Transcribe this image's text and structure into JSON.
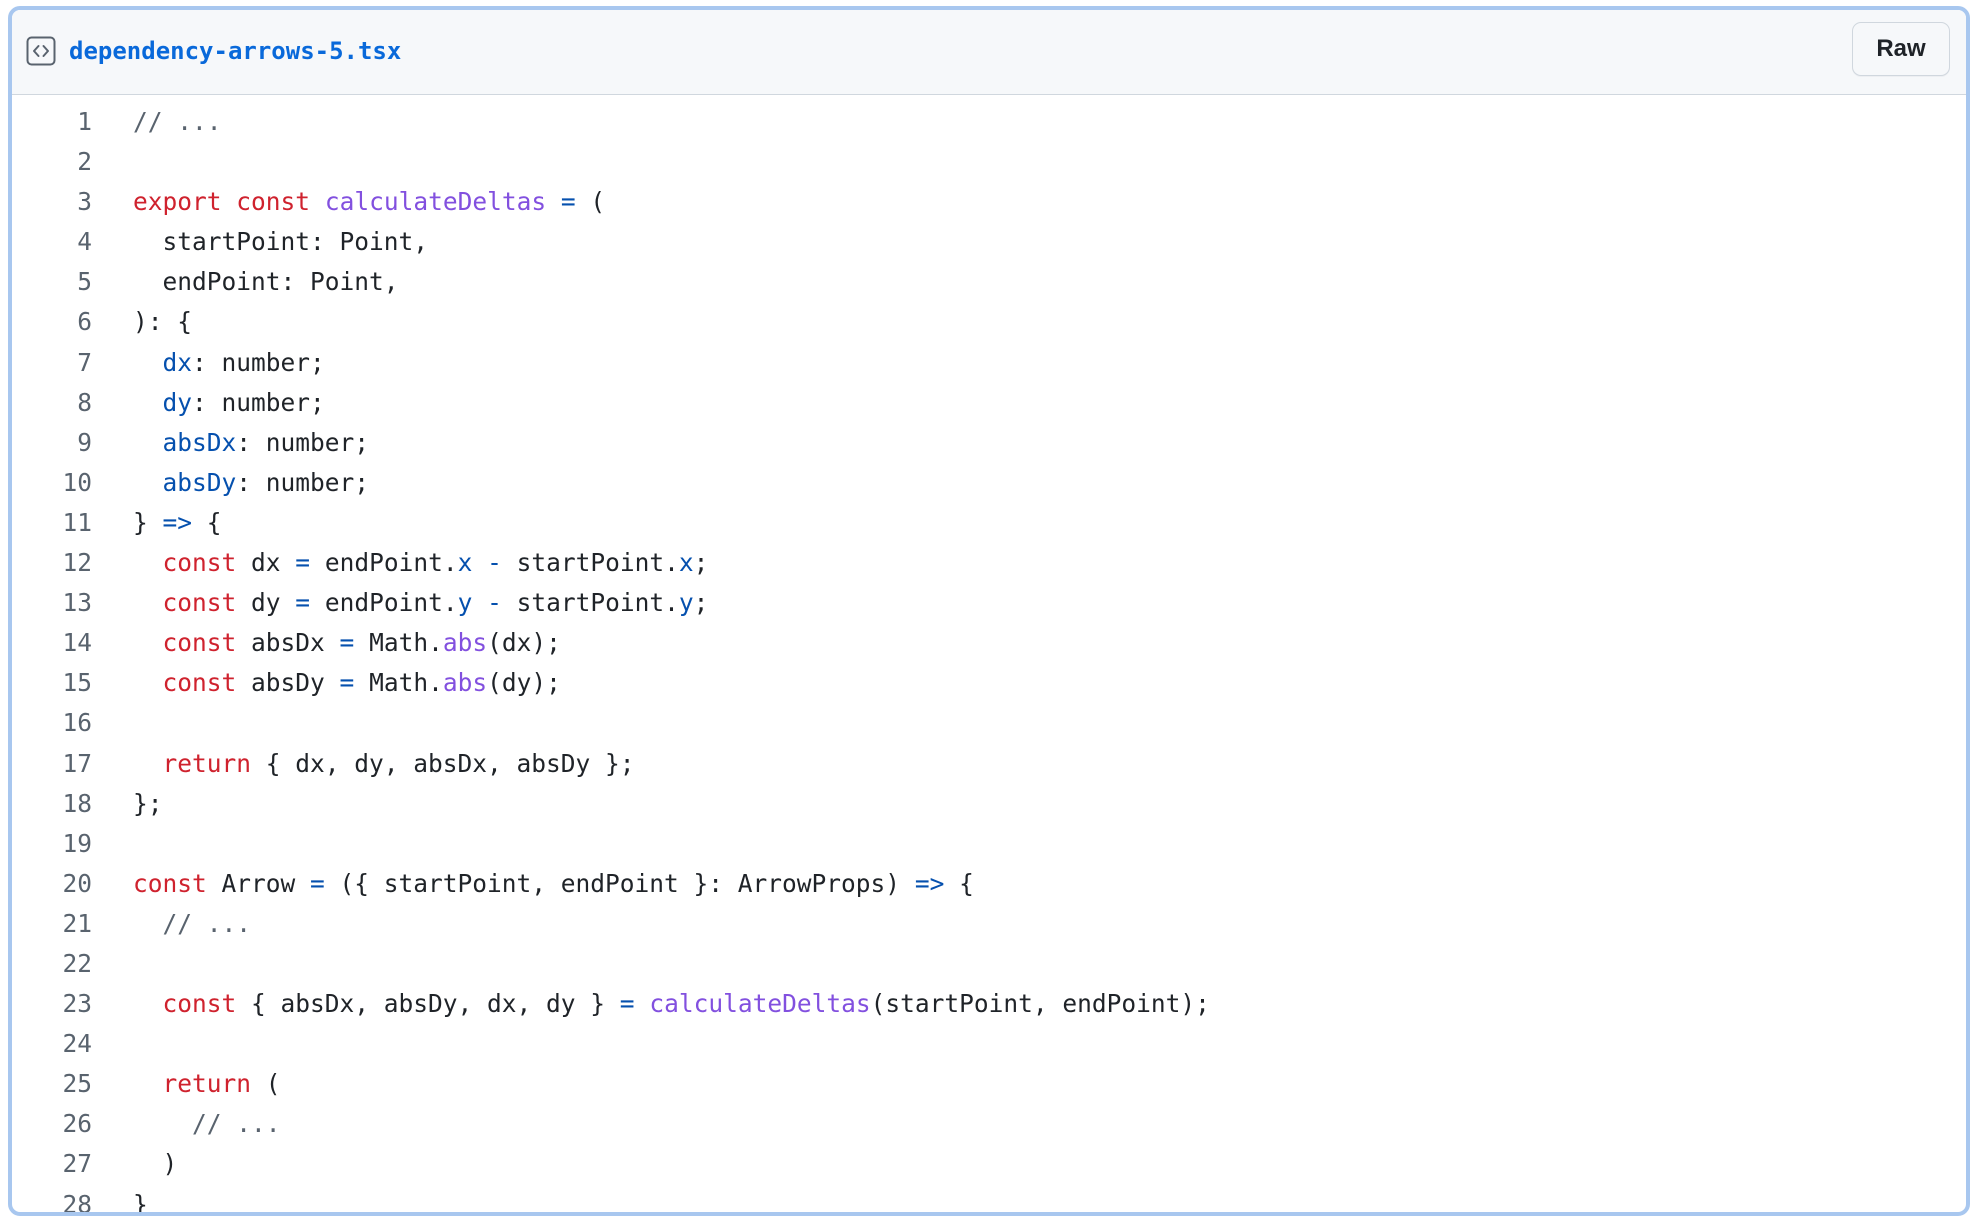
{
  "file": {
    "name": "dependency-arrows-5.tsx",
    "icon": "code-file-icon",
    "raw_label": "Raw"
  },
  "colors": {
    "link": "#0969da",
    "keyword": "#cf222e",
    "function": "#8250df",
    "operator": "#0550ae",
    "property": "#0550ae",
    "comment": "#59636e",
    "text": "#1f2328",
    "line_number": "#59636e"
  },
  "code": {
    "lines": [
      {
        "number": "1",
        "tokens": [
          [
            "comment",
            "// ..."
          ]
        ]
      },
      {
        "number": "2",
        "tokens": []
      },
      {
        "number": "3",
        "tokens": [
          [
            "keyword",
            "export"
          ],
          [
            "plain",
            " "
          ],
          [
            "keyword",
            "const"
          ],
          [
            "plain",
            " "
          ],
          [
            "function",
            "calculateDeltas"
          ],
          [
            "plain",
            " "
          ],
          [
            "operator",
            "="
          ],
          [
            "plain",
            " ("
          ]
        ]
      },
      {
        "number": "4",
        "tokens": [
          [
            "plain",
            "  startPoint: Point,"
          ]
        ]
      },
      {
        "number": "5",
        "tokens": [
          [
            "plain",
            "  endPoint: Point,"
          ]
        ]
      },
      {
        "number": "6",
        "tokens": [
          [
            "plain",
            "): {"
          ]
        ]
      },
      {
        "number": "7",
        "tokens": [
          [
            "plain",
            "  "
          ],
          [
            "property",
            "dx"
          ],
          [
            "plain",
            ": number;"
          ]
        ]
      },
      {
        "number": "8",
        "tokens": [
          [
            "plain",
            "  "
          ],
          [
            "property",
            "dy"
          ],
          [
            "plain",
            ": number;"
          ]
        ]
      },
      {
        "number": "9",
        "tokens": [
          [
            "plain",
            "  "
          ],
          [
            "property",
            "absDx"
          ],
          [
            "plain",
            ": number;"
          ]
        ]
      },
      {
        "number": "10",
        "tokens": [
          [
            "plain",
            "  "
          ],
          [
            "property",
            "absDy"
          ],
          [
            "plain",
            ": number;"
          ]
        ]
      },
      {
        "number": "11",
        "tokens": [
          [
            "plain",
            "} "
          ],
          [
            "operator",
            "=>"
          ],
          [
            "plain",
            " {"
          ]
        ]
      },
      {
        "number": "12",
        "tokens": [
          [
            "plain",
            "  "
          ],
          [
            "keyword",
            "const"
          ],
          [
            "plain",
            " dx "
          ],
          [
            "operator",
            "="
          ],
          [
            "plain",
            " endPoint."
          ],
          [
            "property",
            "x"
          ],
          [
            "plain",
            " "
          ],
          [
            "operator",
            "-"
          ],
          [
            "plain",
            " startPoint."
          ],
          [
            "property",
            "x"
          ],
          [
            "plain",
            ";"
          ]
        ]
      },
      {
        "number": "13",
        "tokens": [
          [
            "plain",
            "  "
          ],
          [
            "keyword",
            "const"
          ],
          [
            "plain",
            " dy "
          ],
          [
            "operator",
            "="
          ],
          [
            "plain",
            " endPoint."
          ],
          [
            "property",
            "y"
          ],
          [
            "plain",
            " "
          ],
          [
            "operator",
            "-"
          ],
          [
            "plain",
            " startPoint."
          ],
          [
            "property",
            "y"
          ],
          [
            "plain",
            ";"
          ]
        ]
      },
      {
        "number": "14",
        "tokens": [
          [
            "plain",
            "  "
          ],
          [
            "keyword",
            "const"
          ],
          [
            "plain",
            " absDx "
          ],
          [
            "operator",
            "="
          ],
          [
            "plain",
            " Math."
          ],
          [
            "function",
            "abs"
          ],
          [
            "plain",
            "(dx);"
          ]
        ]
      },
      {
        "number": "15",
        "tokens": [
          [
            "plain",
            "  "
          ],
          [
            "keyword",
            "const"
          ],
          [
            "plain",
            " absDy "
          ],
          [
            "operator",
            "="
          ],
          [
            "plain",
            " Math."
          ],
          [
            "function",
            "abs"
          ],
          [
            "plain",
            "(dy);"
          ]
        ]
      },
      {
        "number": "16",
        "tokens": []
      },
      {
        "number": "17",
        "tokens": [
          [
            "plain",
            "  "
          ],
          [
            "keyword",
            "return"
          ],
          [
            "plain",
            " { dx, dy, absDx, absDy };"
          ]
        ]
      },
      {
        "number": "18",
        "tokens": [
          [
            "plain",
            "};"
          ]
        ]
      },
      {
        "number": "19",
        "tokens": []
      },
      {
        "number": "20",
        "tokens": [
          [
            "keyword",
            "const"
          ],
          [
            "plain",
            " Arrow "
          ],
          [
            "operator",
            "="
          ],
          [
            "plain",
            " ({ startPoint, endPoint }: ArrowProps) "
          ],
          [
            "operator",
            "=>"
          ],
          [
            "plain",
            " {"
          ]
        ]
      },
      {
        "number": "21",
        "tokens": [
          [
            "plain",
            "  "
          ],
          [
            "comment",
            "// ..."
          ]
        ]
      },
      {
        "number": "22",
        "tokens": []
      },
      {
        "number": "23",
        "tokens": [
          [
            "plain",
            "  "
          ],
          [
            "keyword",
            "const"
          ],
          [
            "plain",
            " { absDx, absDy, dx, dy } "
          ],
          [
            "operator",
            "="
          ],
          [
            "plain",
            " "
          ],
          [
            "function",
            "calculateDeltas"
          ],
          [
            "plain",
            "(startPoint, endPoint);"
          ]
        ]
      },
      {
        "number": "24",
        "tokens": []
      },
      {
        "number": "25",
        "tokens": [
          [
            "plain",
            "  "
          ],
          [
            "keyword",
            "return"
          ],
          [
            "plain",
            " ("
          ]
        ]
      },
      {
        "number": "26",
        "tokens": [
          [
            "plain",
            "    "
          ],
          [
            "comment",
            "// ..."
          ]
        ]
      },
      {
        "number": "27",
        "tokens": [
          [
            "plain",
            "  )"
          ]
        ]
      },
      {
        "number": "28",
        "tokens": [
          [
            "plain",
            "}"
          ]
        ]
      }
    ]
  }
}
